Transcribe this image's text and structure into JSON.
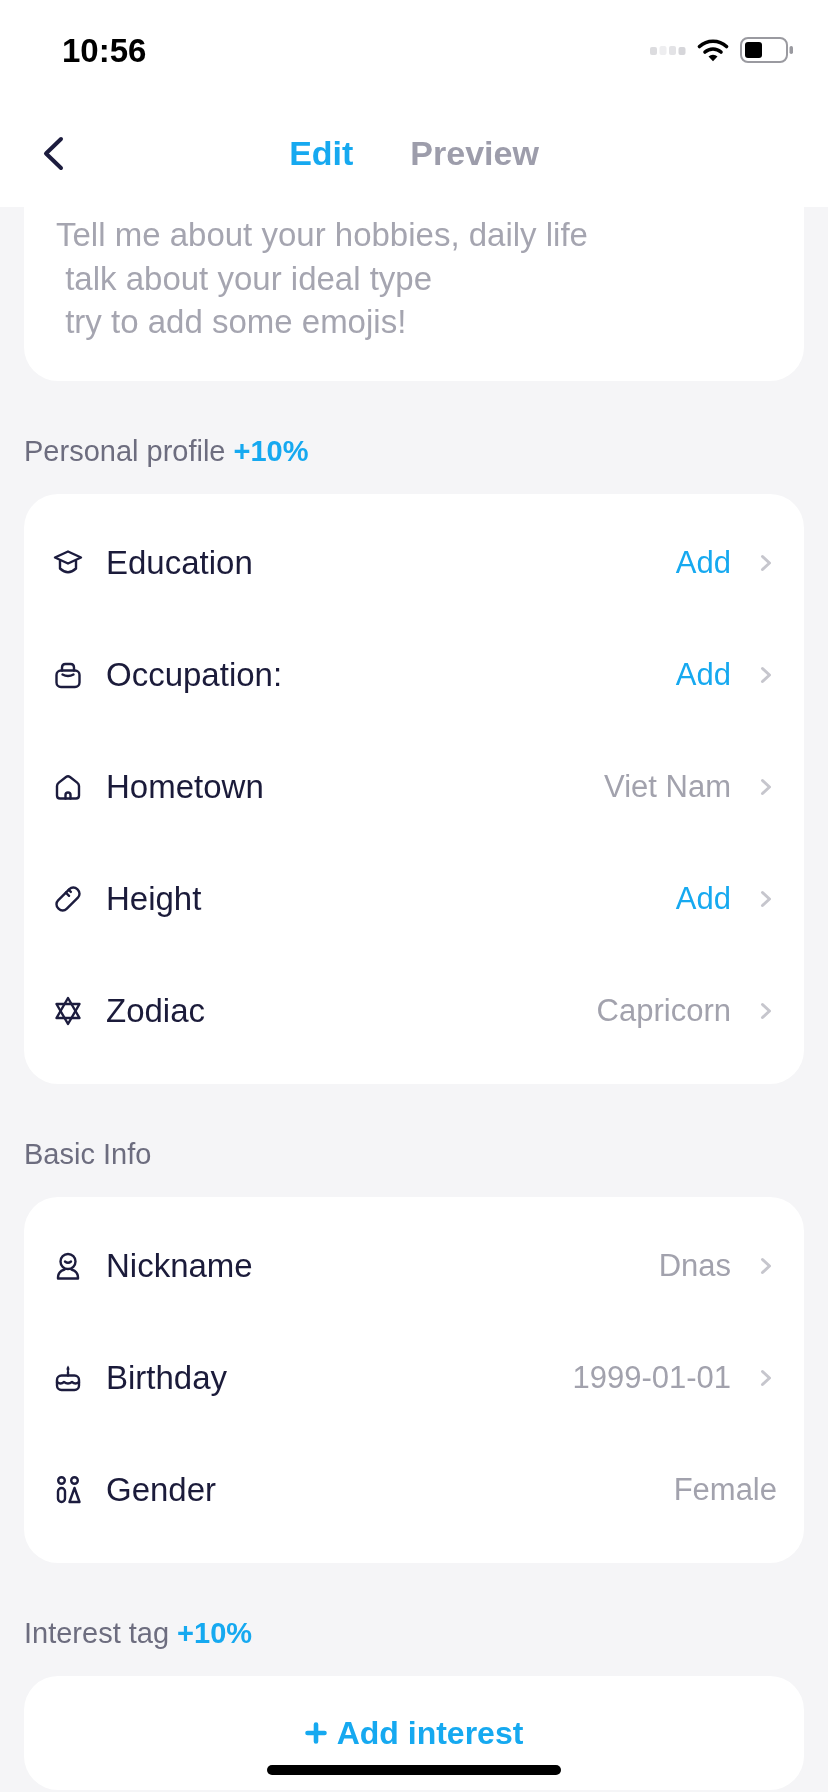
{
  "status_bar": {
    "time": "10:56"
  },
  "header": {
    "tabs": [
      {
        "label": "Edit",
        "selected": true
      },
      {
        "label": "Preview",
        "selected": false
      }
    ]
  },
  "bio": {
    "placeholder": "Tell me about your hobbies, daily life\n talk about your ideal type\n try to add some emojis!"
  },
  "sections": [
    {
      "kind": "list",
      "title": "Personal profile",
      "bonus": "+10%",
      "rows": [
        {
          "label": "Education",
          "value": "Add",
          "kind": "add",
          "chevron": true
        },
        {
          "label": "Occupation:",
          "value": "Add",
          "kind": "add",
          "chevron": true
        },
        {
          "label": "Hometown",
          "value": "Viet Nam",
          "kind": "value",
          "chevron": true
        },
        {
          "label": "Height",
          "value": "Add",
          "kind": "add",
          "chevron": true
        },
        {
          "label": "Zodiac",
          "value": "Capricorn",
          "kind": "value",
          "chevron": true
        }
      ]
    },
    {
      "kind": "list",
      "title": "Basic Info",
      "rows": [
        {
          "label": "Nickname",
          "value": "Dnas",
          "kind": "value",
          "chevron": true
        },
        {
          "label": "Birthday",
          "value": "1999-01-01",
          "kind": "value",
          "chevron": true
        },
        {
          "label": "Gender",
          "value": "Female",
          "kind": "value",
          "chevron": false
        }
      ]
    },
    {
      "kind": "button",
      "title": "Interest tag",
      "bonus": "+10%",
      "button": "Add interest"
    }
  ]
}
